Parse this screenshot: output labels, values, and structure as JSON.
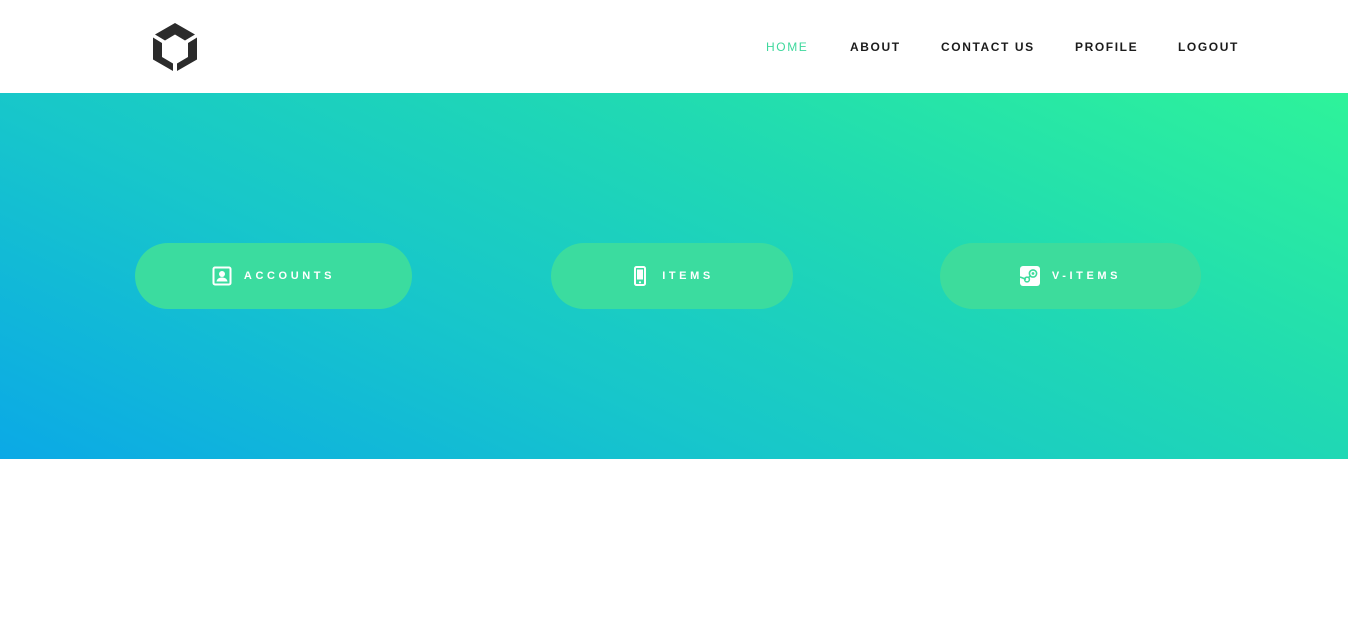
{
  "header": {
    "logo_icon": "hexagon-cube-logo",
    "nav": [
      {
        "label": "HOME",
        "active": true
      },
      {
        "label": "ABOUT",
        "active": false
      },
      {
        "label": "CONTACT US",
        "active": false
      },
      {
        "label": "PROFILE",
        "active": false
      },
      {
        "label": "LOGOUT",
        "active": false
      }
    ]
  },
  "hero": {
    "gradient_colors": [
      "#0ba9e6",
      "#2ef39a"
    ],
    "buttons": [
      {
        "label": "ACCOUNTS",
        "icon": "contact-card-icon"
      },
      {
        "label": "ITEMS",
        "icon": "mobile-phone-icon"
      },
      {
        "label": "V-ITEMS",
        "icon": "steam-icon"
      }
    ]
  },
  "colors": {
    "accent": "#3fd89d",
    "nav_text": "#1c1c1c",
    "pill_bg": "#3bdc9f"
  }
}
